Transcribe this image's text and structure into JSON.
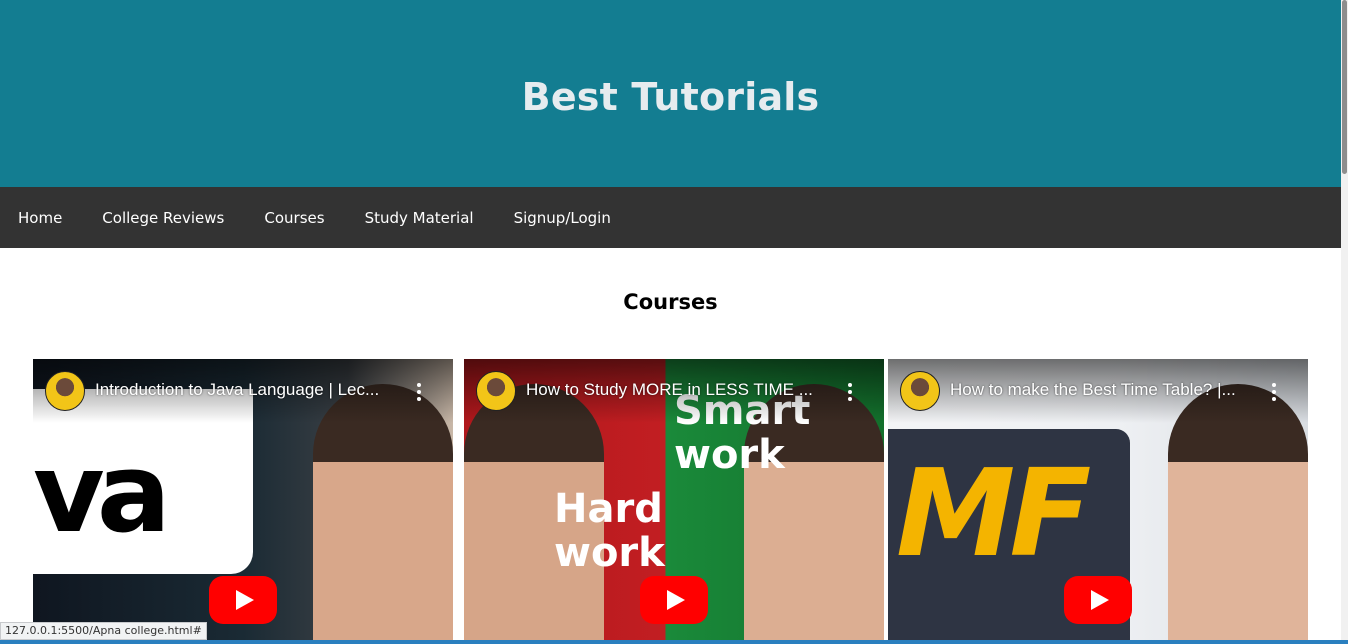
{
  "header": {
    "title": "Best Tutorials"
  },
  "nav": {
    "items": [
      {
        "label": "Home"
      },
      {
        "label": "College Reviews"
      },
      {
        "label": "Courses"
      },
      {
        "label": "Study Material"
      },
      {
        "label": "Signup/Login"
      }
    ]
  },
  "courses": {
    "title": "Courses",
    "videos": [
      {
        "title": "Introduction to Java Language | Lec...",
        "thumb_text": "va"
      },
      {
        "title": "How to Study MORE in LESS TIME ...",
        "thumb_left_text": "Hard\nwork",
        "thumb_right_text": "Smart\nwork"
      },
      {
        "title": "How to make the Best Time Table? |...",
        "thumb_text": "MF"
      }
    ]
  },
  "status_bar": {
    "url": "127.0.0.1:5500/Apna college.html#"
  },
  "colors": {
    "header_bg": "#137d91",
    "nav_bg": "#333333",
    "play_red": "#ff0000"
  }
}
